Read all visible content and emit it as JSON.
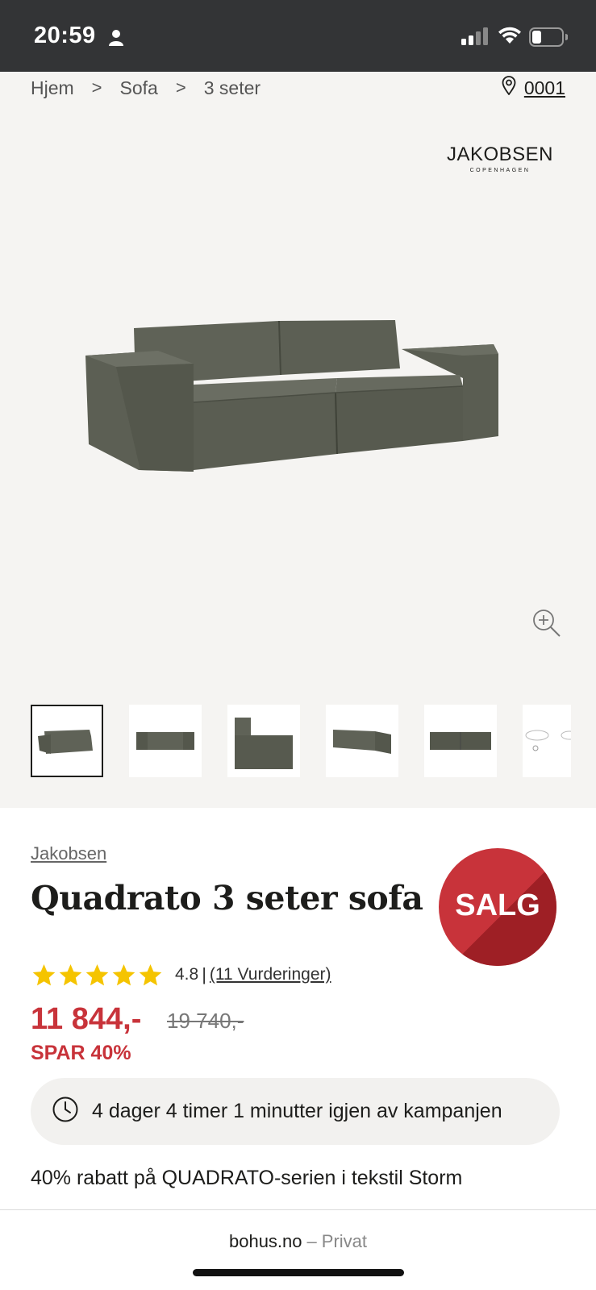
{
  "status_bar": {
    "time": "20:59"
  },
  "breadcrumb": {
    "items": [
      "Hjem",
      "Sofa",
      "3 seter"
    ],
    "separator": ">"
  },
  "store": {
    "code": "0001"
  },
  "brand_logo": {
    "name": "JAKOBSEN",
    "sub": "COPENHAGEN"
  },
  "product": {
    "brand": "Jakobsen",
    "title": "Quadrato 3 seter sofa",
    "badge": "SALG",
    "rating_value": "4.8",
    "rating_count": "(11 Vurderinger)",
    "rating_stars": 5,
    "price_now": "11 844,-",
    "price_old": "19 740,-",
    "save": "SPAR 40%",
    "countdown": "4 dager 4 timer 1 minutter igjen av kampanjen",
    "promo": "40% rabatt på QUADRATO-serien i tekstil Storm"
  },
  "browser": {
    "domain": "bohus.no",
    "dash": "–",
    "mode": "Privat"
  },
  "colors": {
    "sale_red": "#c8333a",
    "star_yellow": "#f5c400",
    "status_bar": "#333436",
    "hero_bg": "#f5f4f2"
  }
}
